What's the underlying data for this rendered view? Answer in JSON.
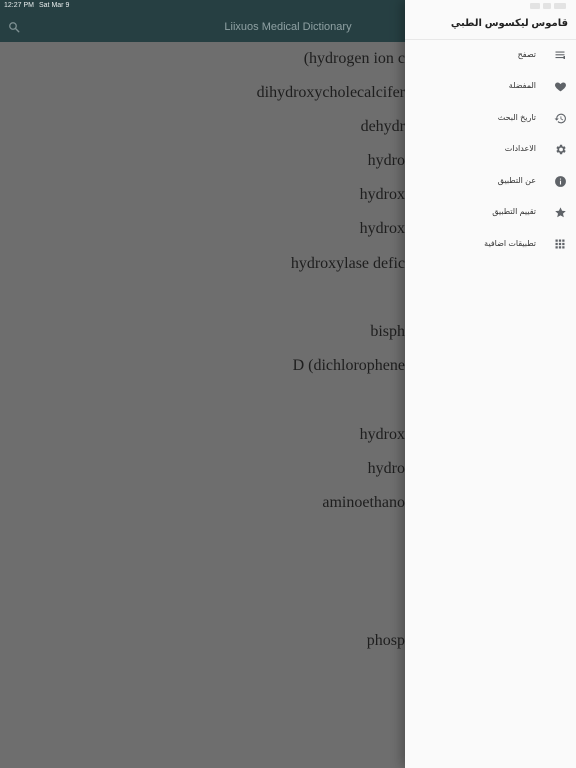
{
  "status_bar": {
    "time": "12:27 PM",
    "date": "Sat Mar 9"
  },
  "app_bar": {
    "title": "Liixuos Medical Dictionary",
    "search_icon": "search-icon"
  },
  "content_rows": [
    "(hydrogen ion c",
    "dihydroxycholecalcifer",
    "dehydr",
    "hydro",
    "hydrox",
    "hydrox",
    "hydroxylase defic",
    "bisph",
    "D (dichlorophene",
    "hydrox",
    "hydro",
    "aminoethano",
    "phosp"
  ],
  "drawer": {
    "title": "قاموس ليكسوس الطبي",
    "items": [
      {
        "label": "تصفح",
        "icon": "list-icon"
      },
      {
        "label": "المفضلة",
        "icon": "heart-icon"
      },
      {
        "label": "تاريخ البحث",
        "icon": "history-icon"
      },
      {
        "label": "الاعدادات",
        "icon": "gear-icon"
      },
      {
        "label": "عن التطبيق",
        "icon": "info-icon"
      },
      {
        "label": "تقييم التطبيق",
        "icon": "star-icon"
      },
      {
        "label": "تطبيقات اضافية",
        "icon": "apps-grid-icon"
      }
    ]
  },
  "colors": {
    "app_bar_dimmed": "#263f42",
    "overlay_background": "#6e6e6e",
    "drawer_background": "#fafafa",
    "icon_color": "#5f6368"
  }
}
